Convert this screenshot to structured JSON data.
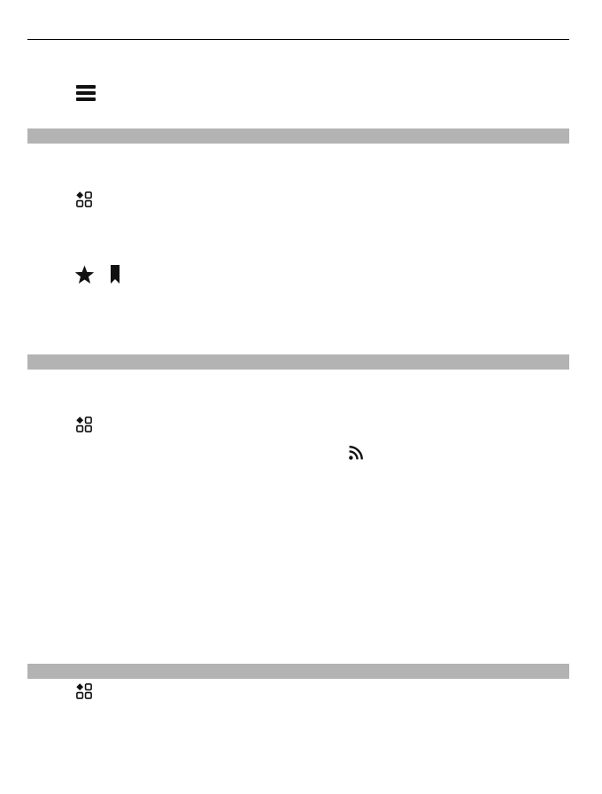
{
  "colors": {
    "rule": "#000000",
    "section_band": "#b3b3b3",
    "icon": "#111111",
    "page_background": "#ffffff"
  },
  "icons": [
    "menu-icon",
    "applications-icon",
    "star-icon",
    "bookmark-icon",
    "applications-icon",
    "rss-feed-icon",
    "applications-icon"
  ]
}
